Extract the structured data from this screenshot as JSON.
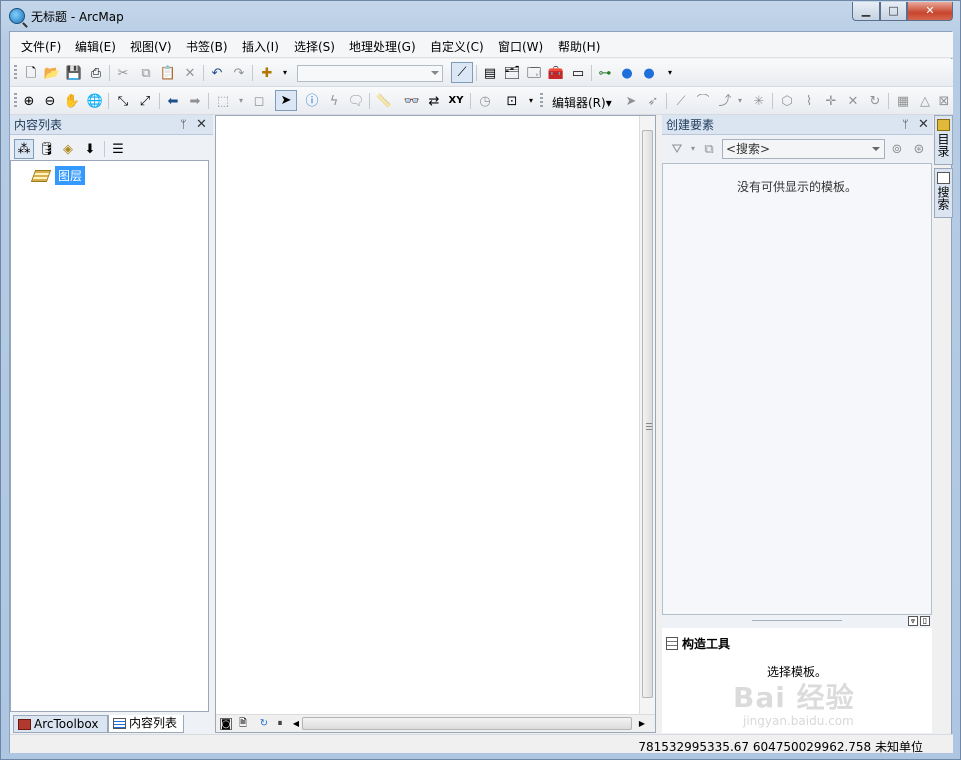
{
  "window": {
    "title": "无标题 - ArcMap",
    "min_label": "▁",
    "max_label": "□",
    "close_label": "✕"
  },
  "menu": [
    {
      "label": "文件(F)"
    },
    {
      "label": "编辑(E)"
    },
    {
      "label": "视图(V)"
    },
    {
      "label": "书签(B)"
    },
    {
      "label": "插入(I)"
    },
    {
      "label": "选择(S)"
    },
    {
      "label": "地理处理(G)"
    },
    {
      "label": "自定义(C)"
    },
    {
      "label": "窗口(W)"
    },
    {
      "label": "帮助(H)"
    }
  ],
  "toolbar": {
    "scale_value": "",
    "editor_label": "编辑器(R)▾"
  },
  "toc": {
    "title": "内容列表",
    "pin": "ᛘ",
    "close": "✕",
    "layer_label": "图层",
    "tabs": [
      {
        "label": "ArcToolbox"
      },
      {
        "label": "内容列表"
      }
    ]
  },
  "create_features": {
    "title": "创建要素",
    "pin": "ᛘ",
    "close": "✕",
    "search_placeholder": "<搜索>",
    "empty_message": "没有可供显示的模板。",
    "construct_title": "构造工具",
    "construct_message": "选择模板。"
  },
  "side_tabs": [
    {
      "label": "目录"
    },
    {
      "label": "搜索"
    }
  ],
  "status": {
    "coordinates": "781532995335.67  604750029962.758 未知单位"
  },
  "watermark": {
    "logo": "Bai 经验",
    "url": "jingyan.baidu.com"
  },
  "colors": {
    "title_bar": "#b7cce4",
    "panel_header": "#dbe5f1",
    "selection": "#3399ff"
  }
}
